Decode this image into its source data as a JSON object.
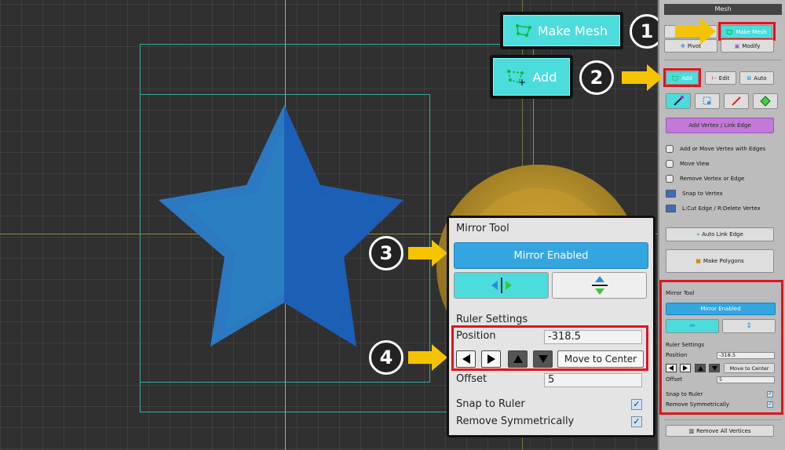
{
  "callouts": {
    "make_mesh_label": "Make Mesh",
    "add_label": "Add",
    "steps": [
      "1",
      "2",
      "3",
      "4"
    ]
  },
  "mirror_tool": {
    "title": "Mirror Tool",
    "enabled_label": "Mirror Enabled",
    "ruler_settings_title": "Ruler Settings",
    "position_label": "Position",
    "position_value": "-318.5",
    "move_to_center_label": "Move to Center",
    "offset_label": "Offset",
    "offset_value": "5",
    "snap_to_ruler_label": "Snap to Ruler",
    "snap_to_ruler_checked": true,
    "remove_symmetrically_label": "Remove Symmetrically",
    "remove_symmetrically_checked": true
  },
  "inspector": {
    "header": "Mesh",
    "make_mesh_label": "Make Mesh",
    "pivot_label": "Pivot",
    "modify_label": "Modify",
    "add_label": "Add",
    "edit_label": "Edit",
    "auto_label": "Auto",
    "add_vertex_link_edge_label": "Add Vertex / Link Edge",
    "hints": [
      "Add or Move Vertex with Edges",
      "Move View",
      "Remove Vertex or Edge",
      "Snap to Vertex",
      "L:Cut Edge / R:Delete Vertex"
    ],
    "auto_link_edge_label": "Auto Link Edge",
    "make_polygons_label": "Make Polygons",
    "mirror_title": "Mirror Tool",
    "mirror_enabled_label": "Mirror Enabled",
    "ruler_settings_title": "Ruler Settings",
    "position_label": "Position",
    "position_value": "-318.5",
    "move_to_center_label": "Move to Center",
    "offset_label": "Offset",
    "offset_value": "5",
    "snap_to_ruler_label": "Snap to Ruler",
    "remove_symmetrically_label": "Remove Symmetrically",
    "remove_all_vertices_label": "Remove All Vertices"
  },
  "colors": {
    "accent_cyan": "#4ddcdc",
    "mirror_blue": "#33a6e2",
    "highlight_red": "#e0141e",
    "arrow_yellow": "#f5c400",
    "star_blue": "#2a7fc0",
    "purple_button": "#c27ad8"
  }
}
